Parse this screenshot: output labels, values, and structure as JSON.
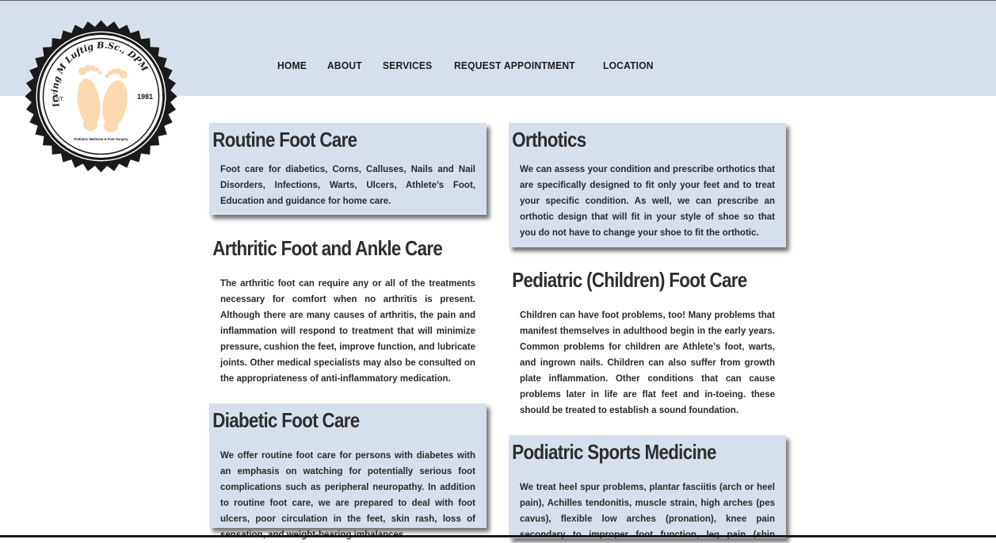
{
  "nav": {
    "items": [
      {
        "label": "HOME"
      },
      {
        "label": "ABOUT"
      },
      {
        "label": "SERVICES"
      },
      {
        "label": "REQUEST APPOINTMENT"
      },
      {
        "label": "LOCATION"
      }
    ]
  },
  "logo": {
    "name": "Irving M Luftig B.Sc., DPM",
    "est": "EST.",
    "year": "1981",
    "tagline": "Podiatric Medicine & Foot Surgery"
  },
  "services": {
    "routine": {
      "title": "Routine Foot Care",
      "body": "Foot care for diabetics, Corns, Calluses, Nails and Nail Disorders, Infections, Warts, Ulcers, Athlete’s Foot, Education and guidance for home care."
    },
    "arthritic": {
      "title": "Arthritic Foot and Ankle Care",
      "body": "The arthritic foot can require any or all of the treatments necessary for comfort when no arthritis is present. Although there are many causes of arthritis, the pain and inflammation will respond to treatment that will minimize pressure, cushion the feet, improve function, and lubricate joints. Other medical specialists may also be consulted on the appropriateness of anti-inflammatory medication."
    },
    "diabetic": {
      "title": "Diabetic Foot Care",
      "body": "We offer routine foot care for persons with diabetes with an emphasis on watching for potentially serious foot complications such as peripheral neuropathy. In addition to routine foot care, we are prepared to deal with foot ulcers, poor circulation in the feet, skin rash, loss of sensation, and weight-bearing imbalances."
    },
    "orthotics": {
      "title": "Orthotics",
      "body": "We can assess your condition and prescribe orthotics that are specifically designed to fit only your feet and to treat your specific condition. As well, we can prescribe an orthotic design that will fit in your style of shoe so that you do not have to change your shoe to fit the orthotic."
    },
    "pediatric": {
      "title": "Pediatric (Children) Foot Care",
      "body": "Children can have foot problems, too! Many problems that manifest themselves in adulthood begin in the early years. Common problems for children are Athlete’s foot, warts, and ingrown nails. Children can also suffer from growth plate inflammation. Other conditions that can cause problems later in life are flat feet and in-toeing. these should be treated to establish a sound foundation."
    },
    "sports": {
      "title": "Podiatric Sports Medicine",
      "body": "We treat heel spur problems, plantar fasciitis (arch or heel pain), Achilles tendonitis, muscle strain, high arches (pes cavus), flexible low arches (pronation), knee pain secondary to improper foot function, leg pain (shin splints), and related low back pain."
    }
  },
  "colors": {
    "header_bg": "#d6e0ed",
    "card_bg": "#d6e0ed",
    "text": "#2b2b2b",
    "foot": "#fcd9ae"
  }
}
